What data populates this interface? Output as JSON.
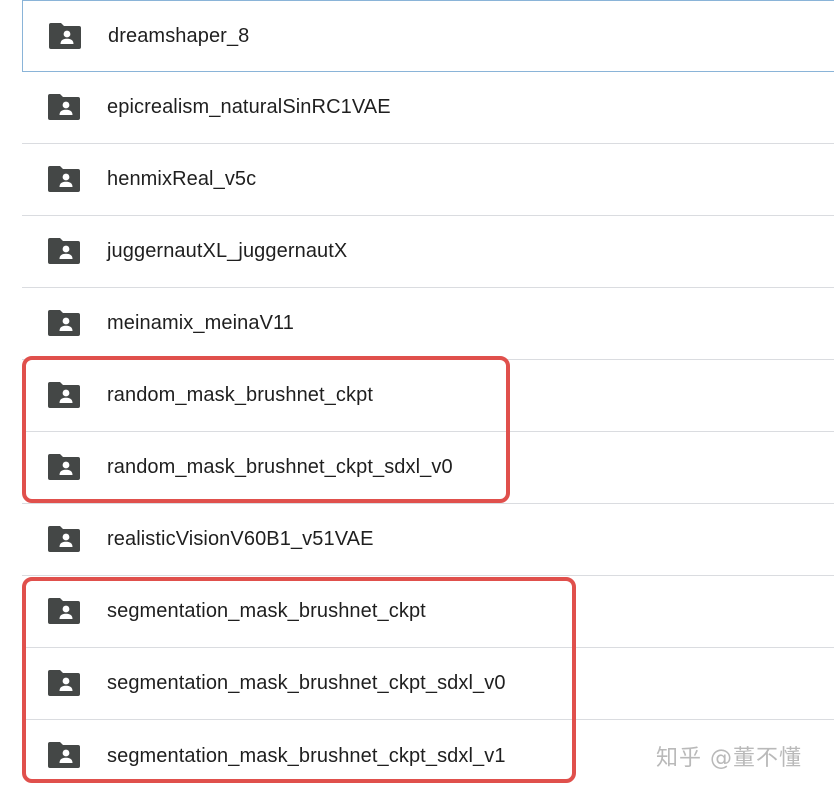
{
  "files": [
    {
      "name": "dreamshaper_8",
      "icon": "shared-folder-icon"
    },
    {
      "name": "epicrealism_naturalSinRC1VAE",
      "icon": "shared-folder-icon"
    },
    {
      "name": "henmixReal_v5c",
      "icon": "shared-folder-icon"
    },
    {
      "name": "juggernautXL_juggernautX",
      "icon": "shared-folder-icon"
    },
    {
      "name": "meinamix_meinaV11",
      "icon": "shared-folder-icon"
    },
    {
      "name": "random_mask_brushnet_ckpt",
      "icon": "shared-folder-icon"
    },
    {
      "name": "random_mask_brushnet_ckpt_sdxl_v0",
      "icon": "shared-folder-icon"
    },
    {
      "name": "realisticVisionV60B1_v51VAE",
      "icon": "shared-folder-icon"
    },
    {
      "name": "segmentation_mask_brushnet_ckpt",
      "icon": "shared-folder-icon"
    },
    {
      "name": "segmentation_mask_brushnet_ckpt_sdxl_v0",
      "icon": "shared-folder-icon"
    },
    {
      "name": "segmentation_mask_brushnet_ckpt_sdxl_v1",
      "icon": "shared-folder-icon"
    }
  ],
  "colors": {
    "highlight": "#e0504c",
    "icon": "#444746",
    "text": "#1f1f1f",
    "divider": "#dadce0"
  },
  "watermark": "知乎 @董不懂"
}
